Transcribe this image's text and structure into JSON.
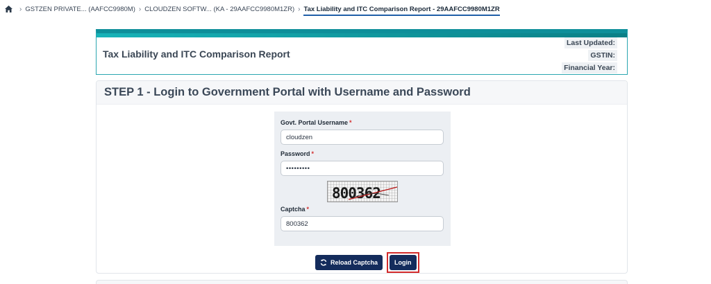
{
  "breadcrumb": {
    "items": [
      "GSTZEN PRIVATE... (AAFCC9980M)",
      "CLOUDZEN SOFTW... (KA - 29AAFCC9980M1ZR)"
    ],
    "current": "Tax Liability and ITC Comparison Report - 29AAFCC9980M1ZR"
  },
  "report": {
    "title": "Tax Liability and ITC Comparison Report",
    "last_updated_label": "Last Updated:",
    "gstin_label": "GSTIN:",
    "financial_year_label": "Financial Year:"
  },
  "step": {
    "title": "STEP 1 - Login to Government Portal with Username and Password"
  },
  "form": {
    "username_label": "Govt. Portal Username",
    "username_value": "cloudzen",
    "password_label": "Password",
    "password_value": "•••••••••",
    "captcha_image_text": "800362",
    "captcha_label": "Captcha",
    "captcha_value": "800362",
    "required_mark": "*"
  },
  "buttons": {
    "reload_captcha": "Reload Captcha",
    "login": "Login"
  },
  "colors": {
    "header_accent": "#0e8f9a",
    "primary_button": "#142c5c",
    "highlight": "#d22b2b",
    "required": "#d32f2f"
  }
}
